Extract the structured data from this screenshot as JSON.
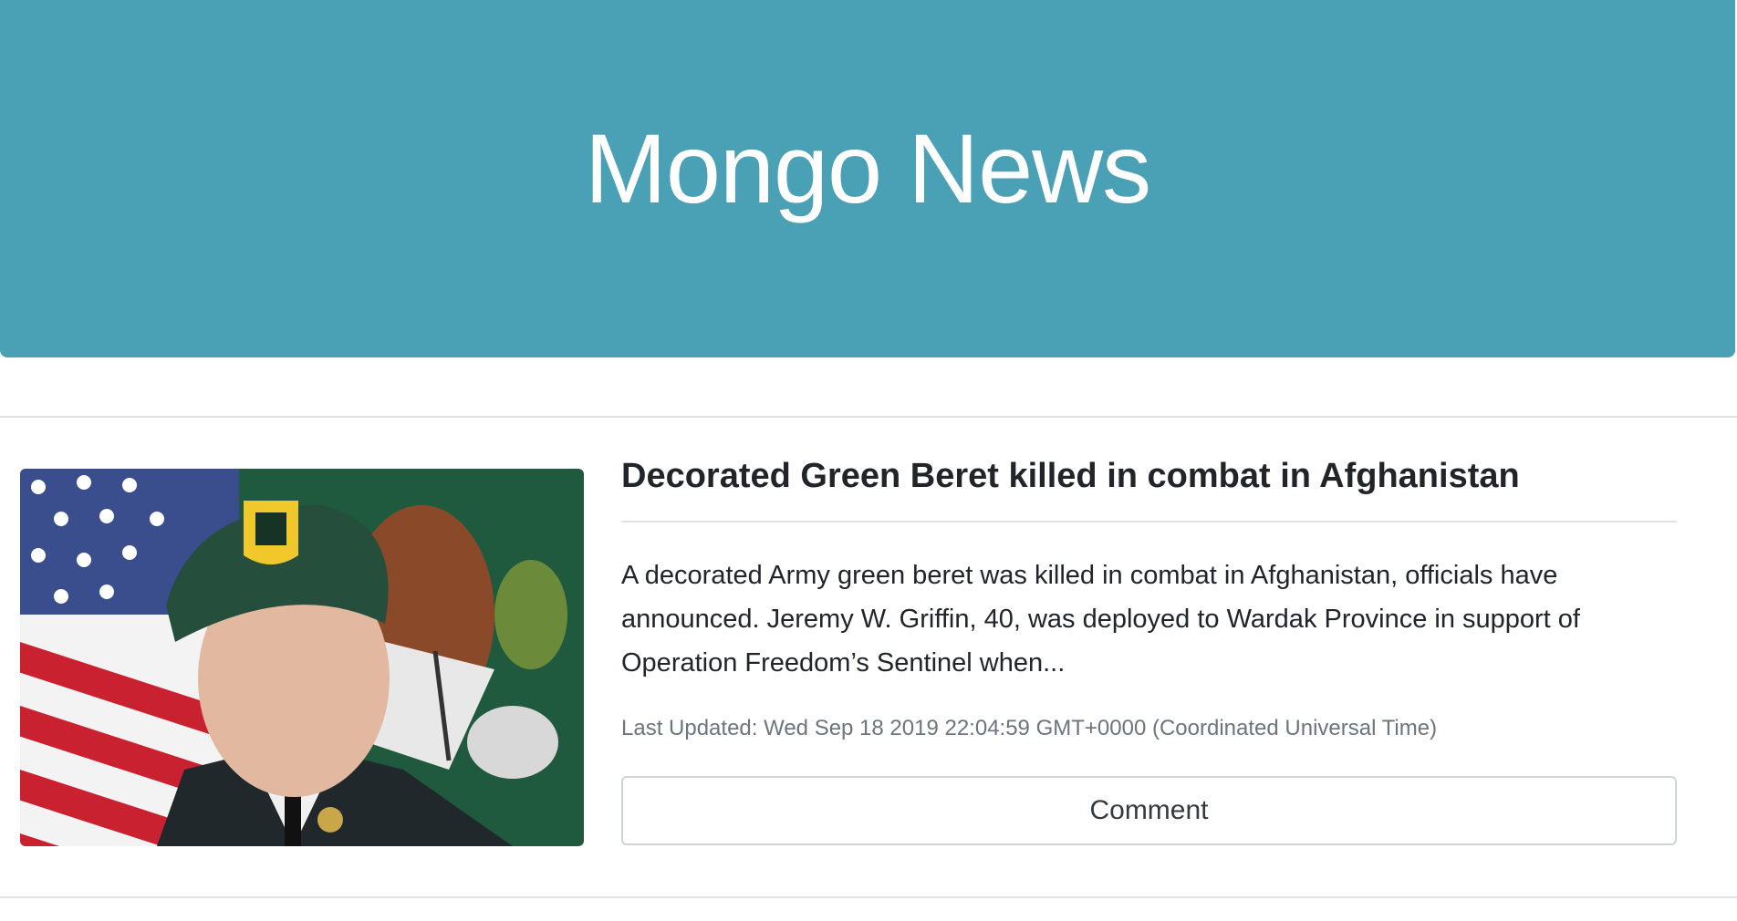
{
  "header": {
    "title": "Mongo News",
    "background_color": "#4aa0b5"
  },
  "article": {
    "image_alt": "Decorated Green Beret portrait",
    "title": "Decorated Green Beret killed in combat in Afghanistan",
    "summary": "A decorated Army green beret was killed in combat in Afghanistan, officials have announced. Jeremy W. Griffin, 40, was deployed to Wardak Province in support of Operation Freedom’s Sentinel when...",
    "last_updated": "Last Updated: Wed Sep 18 2019 22:04:59 GMT+0000 (Coordinated Universal Time)",
    "comment_label": "Comment"
  }
}
